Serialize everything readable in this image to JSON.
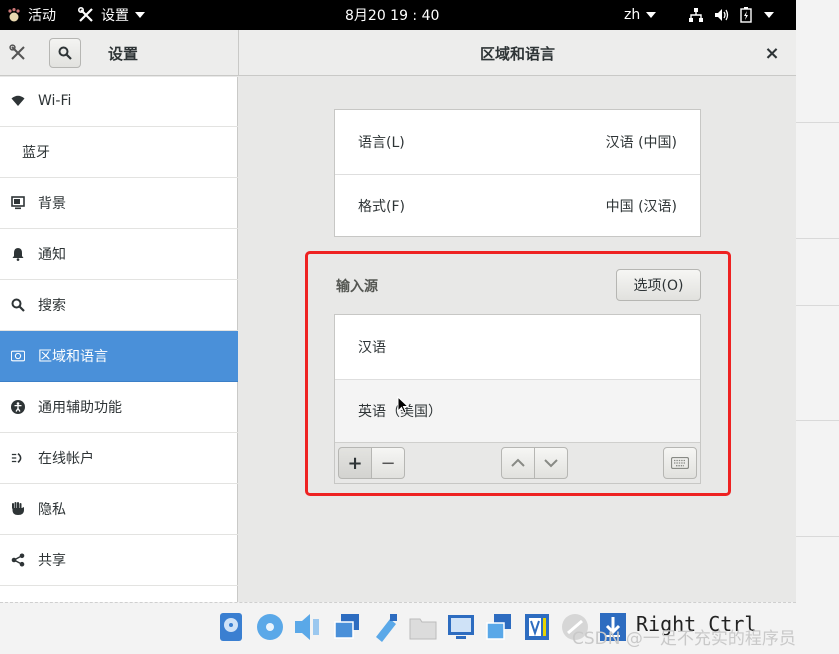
{
  "topbar": {
    "activities": "活动",
    "app_menu": "设置",
    "clock": "8月20 19 : 40",
    "language": "zh"
  },
  "window": {
    "left_title": "设置",
    "title": "区域和语言",
    "close_label": "×"
  },
  "sidebar": {
    "items": [
      {
        "label": "Wi-Fi",
        "icon": "wifi-icon"
      },
      {
        "label": "蓝牙",
        "icon": ""
      },
      {
        "label": "背景",
        "icon": "monitor-icon"
      },
      {
        "label": "通知",
        "icon": "bell-icon"
      },
      {
        "label": "搜索",
        "icon": "search-icon"
      },
      {
        "label": "区域和语言",
        "icon": "region-icon",
        "active": true
      },
      {
        "label": "通用辅助功能",
        "icon": "accessibility-icon"
      },
      {
        "label": "在线帐户",
        "icon": "online-accounts-icon"
      },
      {
        "label": "隐私",
        "icon": "hand-icon"
      },
      {
        "label": "共享",
        "icon": "share-icon"
      }
    ]
  },
  "locale_settings": {
    "language": {
      "label": "语言(L)",
      "value": "汉语 (中国)"
    },
    "formats": {
      "label": "格式(F)",
      "value": "中国 (汉语)"
    }
  },
  "input_sources": {
    "heading": "输入源",
    "options_button": "选项(O)",
    "items": [
      "汉语",
      "英语（美国）"
    ],
    "toolbar": {
      "add": "+",
      "remove": "−"
    }
  },
  "taskbar": {
    "host_key": "Right Ctrl"
  },
  "watermark": "CSDN @一足不充实的程序员",
  "colors": {
    "accent": "#4a90d9",
    "highlight_box": "#ee2222",
    "topbar": "#000000"
  }
}
